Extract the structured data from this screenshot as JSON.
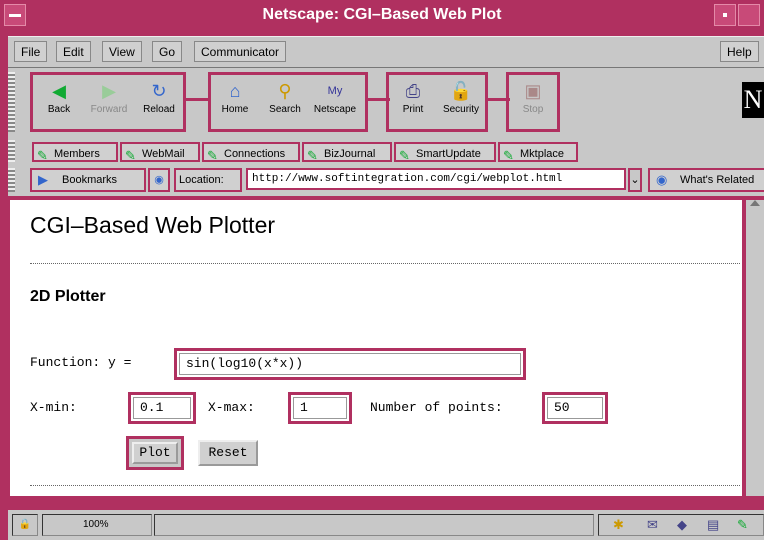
{
  "window": {
    "title": "Netscape: CGI–Based Web Plot"
  },
  "menubar": {
    "items": [
      "File",
      "Edit",
      "View",
      "Go",
      "Communicator"
    ],
    "help": "Help"
  },
  "toolbar": {
    "buttons": [
      {
        "label": "Back",
        "icon": "back-arrow-icon"
      },
      {
        "label": "Forward",
        "icon": "forward-arrow-icon"
      },
      {
        "label": "Reload",
        "icon": "reload-icon"
      },
      {
        "label": "Home",
        "icon": "home-icon"
      },
      {
        "label": "Search",
        "icon": "search-icon"
      },
      {
        "label": "Netscape",
        "icon": "netscape-icon"
      },
      {
        "label": "Print",
        "icon": "print-icon"
      },
      {
        "label": "Security",
        "icon": "lock-icon"
      },
      {
        "label": "Stop",
        "icon": "stop-icon"
      }
    ],
    "logo": "N"
  },
  "personal_toolbar": {
    "items": [
      "Members",
      "WebMail",
      "Connections",
      "BizJournal",
      "SmartUpdate",
      "Mktplace"
    ]
  },
  "location_bar": {
    "bookmarks_label": "Bookmarks",
    "location_label": "Location:",
    "url": "http://www.softintegration.com/cgi/webplot.html",
    "whats_related": "What's Related"
  },
  "page": {
    "title": "CGI–Based Web Plotter",
    "section_title": "2D Plotter",
    "function_label": "Function: y =",
    "function_value": "sin(log10(x*x))",
    "xmin_label": "X-min:",
    "xmin_value": "0.1",
    "xmax_label": "X-max:",
    "xmax_value": "1",
    "npoints_label": "Number of points:",
    "npoints_value": "50",
    "plot_button": "Plot",
    "reset_button": "Reset"
  },
  "statusbar": {
    "zoom": "100%"
  },
  "colors": {
    "frame": "#b03060",
    "chrome": "#c8c8c8"
  }
}
